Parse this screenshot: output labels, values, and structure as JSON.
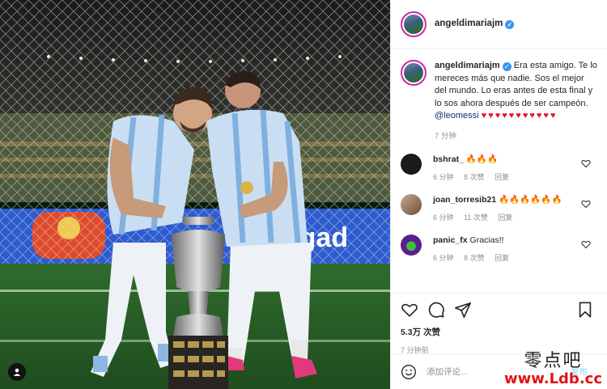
{
  "post": {
    "username": "angeldimariajm",
    "verified_mark": "✓"
  },
  "caption": {
    "username": "angeldimariajm",
    "text": "Era esta amigo. Te lo mereces más que nadie. Sos el mejor del mundo. Lo eras antes de esta final y lo sos ahora después de ser campeón.",
    "mention": "@leomessi",
    "hearts": "♥♥♥♥♥♥♥♥♥♥♥",
    "time": "7 分钟"
  },
  "comments": [
    {
      "user": "bshrat_",
      "text": "🔥🔥🔥",
      "time": "6 分钟",
      "likes": "8 次赞",
      "reply": "回复"
    },
    {
      "user": "joan_torresib21",
      "text": "🔥🔥🔥🔥🔥🔥",
      "time": "6 分钟",
      "likes": "11 次赞",
      "reply": "回复"
    },
    {
      "user": "panic_fx",
      "text": "Gracias!!",
      "time": "6 分钟",
      "likes": "8 次赞",
      "reply": "回复"
    }
  ],
  "stats": {
    "likes": "5.3万 次赞",
    "ago": "7 分钟前"
  },
  "add_comment": {
    "placeholder": "添加评论...",
    "post_label": "发布"
  },
  "watermark": {
    "cn": "零点吧",
    "url": "www.Ldb.cc"
  },
  "photo": {
    "banner_text": "bligad"
  },
  "colors": {
    "accent_blue": "#3897f0",
    "heart_red": "#e3143b",
    "ring": "#d6249f"
  }
}
